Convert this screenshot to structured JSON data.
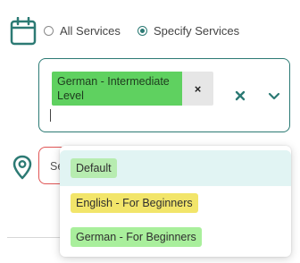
{
  "service_filter": {
    "options": [
      {
        "label": "All Services",
        "selected": false
      },
      {
        "label": "Specify Services",
        "selected": true
      }
    ]
  },
  "services_select": {
    "selected_chips": [
      {
        "label": "German - Intermediate Level",
        "color": "#5fd160"
      }
    ],
    "chip_remove_glyph": "×"
  },
  "location": {
    "placeholder": "Se"
  },
  "dropdown": {
    "options": [
      {
        "label": "Default",
        "color": "#b7ecb0",
        "highlighted": true
      },
      {
        "label": "English - For Beginners",
        "color": "#f2e56a",
        "highlighted": false
      },
      {
        "label": "German - For Beginners",
        "color": "#a9ef9c",
        "highlighted": false
      }
    ]
  },
  "colors": {
    "accent": "#2c7a74",
    "error_border": "#e05555",
    "highlight_row": "#e1f4f3"
  }
}
